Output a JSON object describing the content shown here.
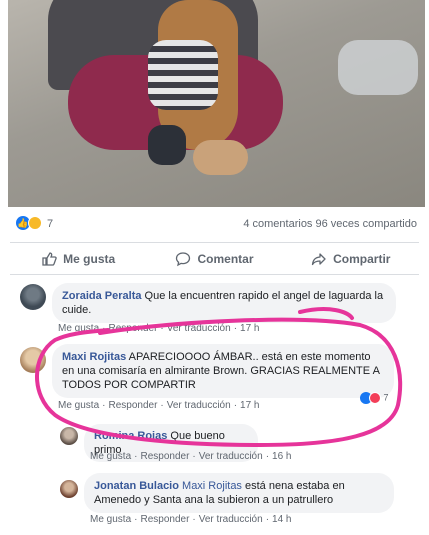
{
  "post": {
    "reaction_count": "7",
    "stats_text": "4 comentarios  96 veces compartido"
  },
  "actions": {
    "like": "Me gusta",
    "comment": "Comentar",
    "share": "Compartir"
  },
  "comments": [
    {
      "author": "Zoraida Peralta",
      "text": "Que la encuentren rapido el angel de laguarda la cuide.",
      "like": "Me gusta",
      "reply": "Responder",
      "translate": "Ver traducción",
      "time": "17 h"
    },
    {
      "author": "Maxi Rojitas",
      "text": "APARECIOOOO ÁMBAR.. está en este momento en una comisaría en almirante Brown. GRACIAS REALMENTE A TODOS POR COMPARTIR",
      "like": "Me gusta",
      "reply": "Responder",
      "translate": "Ver traducción",
      "time": "17 h",
      "reaction_count": "7"
    },
    {
      "author": "Romina Rojas",
      "text": "Que bueno primo",
      "like": "Me gusta",
      "reply": "Responder",
      "translate": "Ver traducción",
      "time": "16 h"
    },
    {
      "author": "Jonatan Bulacio",
      "mention": "Maxi Rojitas",
      "text": "está nena estaba en Amenedo y Santa ana la subieron a un patrullero",
      "like": "Me gusta",
      "reply": "Responder",
      "translate": "Ver traducción",
      "time": "14 h"
    }
  ],
  "colors": {
    "link": "#385898",
    "bubble": "#f2f3f5",
    "annotation": "#e6349a",
    "like_blue": "#1877f2"
  }
}
